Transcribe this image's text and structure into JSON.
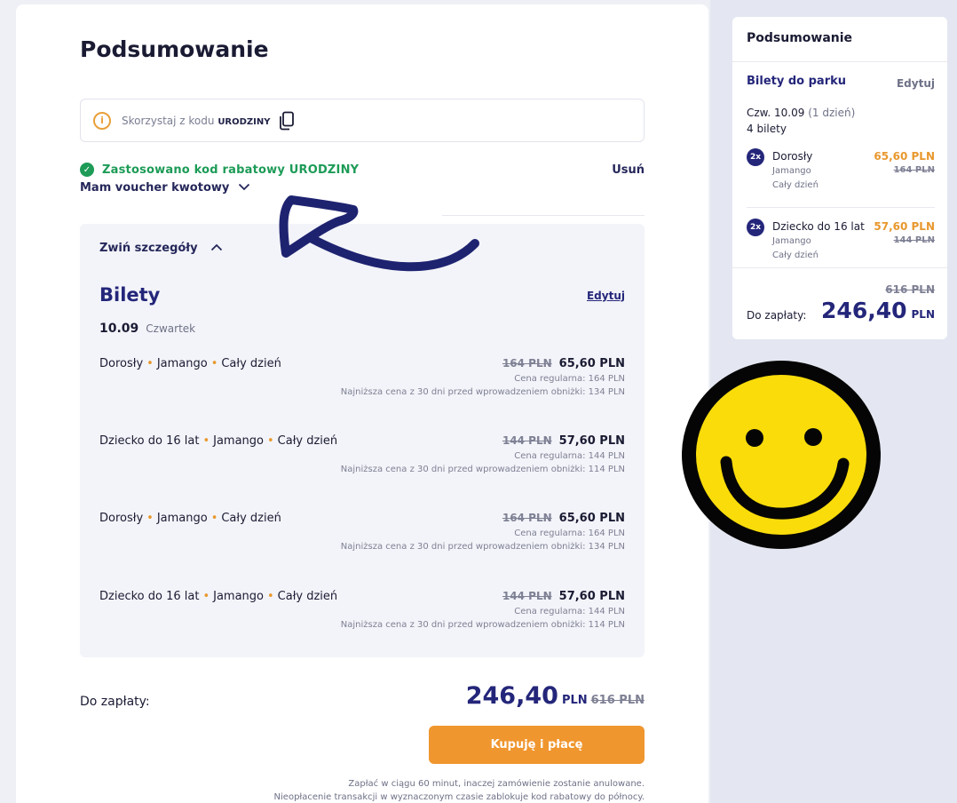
{
  "main": {
    "title": "Podsumowanie",
    "code_hint_prefix": "Skorzystaj z kodu",
    "code_hint_code": "URODZINY",
    "applied_text": "Zastosowano kod rabatowy URODZINY",
    "remove_label": "Usuń",
    "voucher_label": "Mam voucher kwotowy",
    "details": {
      "collapse_label": "Zwiń szczegóły",
      "section_title": "Bilety",
      "edit_label": "Edytuj",
      "date_main": "10.09",
      "date_day": "Czwartek",
      "lines": [
        {
          "type": "Dorosły",
          "park": "Jamango",
          "duration": "Cały dzień",
          "old_price": "164 PLN",
          "new_price": "65,60 PLN",
          "regular": "Cena regularna: 164 PLN",
          "lowest": "Najniższa cena z 30 dni przed wprowadzeniem obniżki: 134 PLN"
        },
        {
          "type": "Dziecko do 16 lat",
          "park": "Jamango",
          "duration": "Cały dzień",
          "old_price": "144 PLN",
          "new_price": "57,60 PLN",
          "regular": "Cena regularna: 144 PLN",
          "lowest": "Najniższa cena z 30 dni przed wprowadzeniem obniżki: 114 PLN"
        },
        {
          "type": "Dorosły",
          "park": "Jamango",
          "duration": "Cały dzień",
          "old_price": "164 PLN",
          "new_price": "65,60 PLN",
          "regular": "Cena regularna: 164 PLN",
          "lowest": "Najniższa cena z 30 dni przed wprowadzeniem obniżki: 134 PLN"
        },
        {
          "type": "Dziecko do 16 lat",
          "park": "Jamango",
          "duration": "Cały dzień",
          "old_price": "144 PLN",
          "new_price": "57,60 PLN",
          "regular": "Cena regularna: 144 PLN",
          "lowest": "Najniższa cena z 30 dni przed wprowadzeniem obniżki: 114 PLN"
        }
      ]
    },
    "total_label": "Do zapłaty:",
    "total_amount": "246,40",
    "total_currency": "PLN",
    "total_old": "616 PLN",
    "buy_label": "Kupuję i płacę",
    "footnote_1": "Zapłać w ciągu 60 minut, inaczej zamówienie zostanie anulowane.",
    "footnote_2": "Nieopłacenie transakcji w wyznaczonym czasie zablokuje kod rabatowy do północy."
  },
  "sidebar": {
    "title": "Podsumowanie",
    "section": "Bilety do parku",
    "edit_label": "Edytuj",
    "date": "Czw. 10.09",
    "date_suffix": "(1 dzień)",
    "count": "4 bilety",
    "items": [
      {
        "qty": "2x",
        "name": "Dorosły",
        "park": "Jamango",
        "duration": "Cały dzień",
        "price": "65,60 PLN",
        "old": "164 PLN"
      },
      {
        "qty": "2x",
        "name": "Dziecko do 16 lat",
        "park": "Jamango",
        "duration": "Cały dzień",
        "price": "57,60 PLN",
        "old": "144 PLN"
      }
    ],
    "old_total": "616 PLN",
    "total_label": "Do zapłaty:",
    "total_amount": "246,40",
    "total_currency": "PLN"
  },
  "colors": {
    "accent_navy": "#24267a",
    "accent_orange": "#f0962e",
    "success_green": "#1d9b57",
    "smiley_yellow": "#f9dc0a"
  },
  "icons": [
    "info-icon",
    "copy-icon",
    "check-circle-icon",
    "chevron-down-icon",
    "chevron-up-icon",
    "smiley-face-drawing",
    "hand-drawn-arrow"
  ]
}
